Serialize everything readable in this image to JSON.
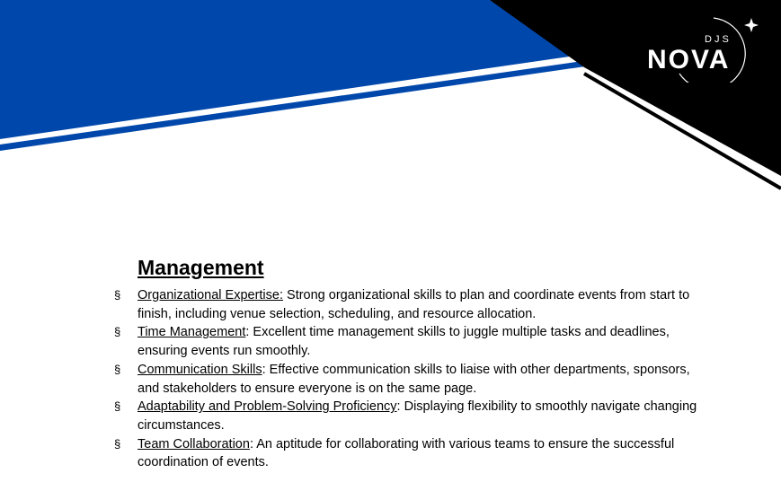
{
  "logo": {
    "small": "DJS",
    "main": "NOVA"
  },
  "colors": {
    "accent_blue": "#0047ab",
    "band_black": "#000000"
  },
  "section": {
    "title": "Management",
    "bullet_symbol": "§",
    "items": [
      {
        "term": "Organizational Expertise:",
        "line1": " Strong organizational skills to plan and coordinate events from start to",
        "line2": "finish, including venue selection, scheduling, and resource allocation."
      },
      {
        "term": "Time Management",
        "line1": ": Excellent time management skills to juggle multiple tasks and deadlines,",
        "line2": "ensuring events run smoothly."
      },
      {
        "term": "Communication Skills",
        "line1": ": Effective communication skills to liaise with other departments, sponsors,",
        "line2": "and stakeholders to ensure everyone is on the same page."
      },
      {
        "term": "Adaptability and Problem-Solving Proficiency",
        "line1": ": Displaying flexibility to smoothly navigate changing",
        "line2": "circumstances."
      },
      {
        "term": "Team Collaboration",
        "line1": ": An aptitude for collaborating with various teams to ensure the successful",
        "line2": "coordination of events."
      }
    ]
  }
}
